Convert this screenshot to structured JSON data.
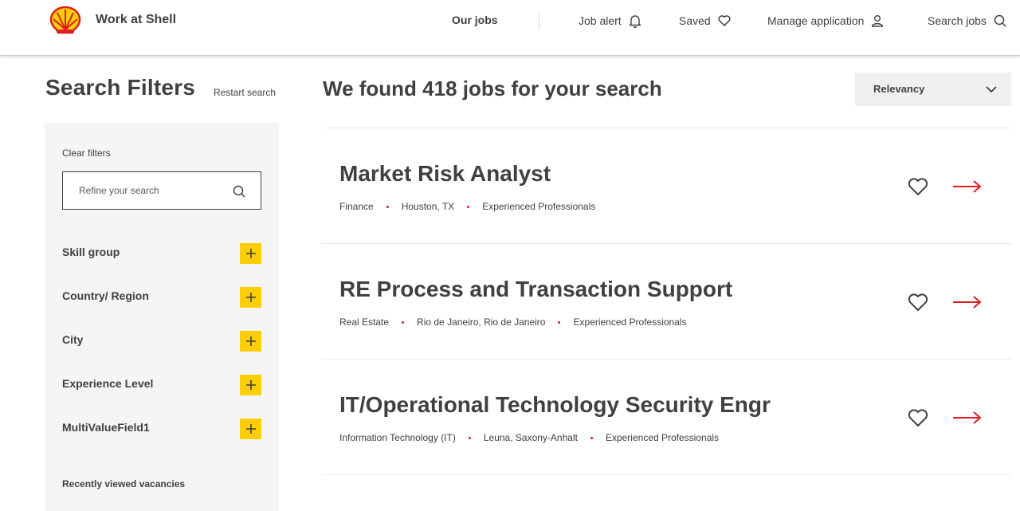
{
  "header": {
    "brand": "Work at Shell",
    "nav": {
      "our_jobs": "Our jobs",
      "job_alert": "Job alert",
      "saved": "Saved",
      "manage_application": "Manage application",
      "search_jobs": "Search jobs"
    },
    "icons": [
      "shell-logo-icon",
      "bell-icon",
      "heart-icon",
      "user-icon",
      "search-icon"
    ]
  },
  "sidebar": {
    "title": "Search Filters",
    "restart": "Restart search",
    "clear_filters": "Clear filters",
    "refine_placeholder": "Refine your search",
    "refine_value": "",
    "facets": [
      {
        "label": "Skill group"
      },
      {
        "label": "Country/ Region"
      },
      {
        "label": "City"
      },
      {
        "label": "Experience Level"
      },
      {
        "label": "MultiValueField1"
      }
    ],
    "recently_viewed": "Recently viewed vacancies"
  },
  "results": {
    "title": "We found 418 jobs for your search",
    "sort": "Relevancy",
    "jobs": [
      {
        "title": "Market Risk Analyst",
        "function": "Finance",
        "location": "Houston, TX",
        "level": "Experienced Professionals"
      },
      {
        "title": "RE Process and Transaction Support",
        "function": "Real Estate",
        "location": "Rio de Janeiro, Rio de Janeiro",
        "level": "Experienced Professionals"
      },
      {
        "title": "IT/Operational Technology Security Engr",
        "function": "Information Technology (IT)",
        "location": "Leuna, Saxony-Anhalt",
        "level": "Experienced Professionals"
      }
    ]
  },
  "colors": {
    "shell_yellow": "#fbce07",
    "shell_red": "#dd1d21",
    "text": "#404040",
    "panel": "#f5f5f5"
  }
}
